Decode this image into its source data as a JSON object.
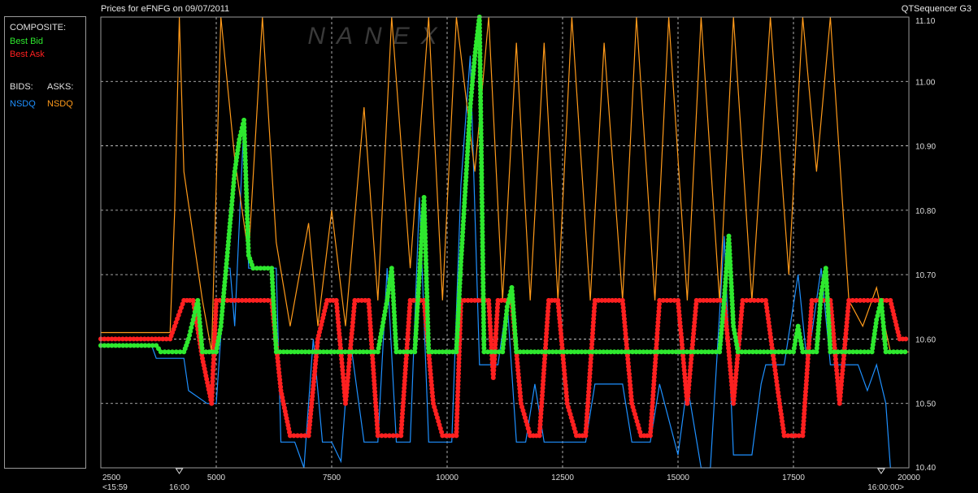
{
  "header": {
    "title": "Prices for  eFNFG  on  09/07/2011",
    "app_name": "QTSequencer G3"
  },
  "watermark": "NANEX",
  "legend": {
    "composite_label": "COMPOSITE:",
    "best_bid_label": "Best Bid",
    "best_ask_label": "Best Ask",
    "bids_label": "BIDS:",
    "asks_label": "ASKS:",
    "bids_exchange": "NSDQ",
    "asks_exchange": "NSDQ"
  },
  "colors": {
    "background": "#000000",
    "best_bid": "#2ee82e",
    "best_ask": "#ff2020",
    "bids_nsdq": "#1e90ff",
    "asks_nsdq": "#ff9a1a",
    "grid": "#d8d8d8",
    "frame": "#9a9a9a"
  },
  "chart_data": {
    "type": "line",
    "ylim": [
      10.4,
      11.1
    ],
    "xlim": [
      2500,
      20000
    ],
    "grid": true,
    "y_ticks": [
      "11.10",
      "11.00",
      "10.90",
      "10.80",
      "10.70",
      "10.60",
      "10.50",
      "10.40"
    ],
    "y_tick_values": [
      11.1,
      11.0,
      10.9,
      10.8,
      10.7,
      10.6,
      10.5,
      10.4
    ],
    "x_ticks": [
      "2500",
      "5000",
      "7500",
      "10000",
      "12500",
      "15000",
      "17500",
      "20000"
    ],
    "x_tick_values": [
      2500,
      5000,
      7500,
      10000,
      12500,
      15000,
      17500,
      20000
    ],
    "x_grid_values": [
      5000,
      7500,
      10000,
      12500,
      15000,
      17500
    ],
    "x_sub_labels": [
      "<15:59",
      "16:00",
      "16:00:00>"
    ],
    "x_sub_label_values": [
      2500,
      4200,
      19500
    ],
    "x_markers": [
      4200,
      19400
    ],
    "series": [
      {
        "name": "Best Bid",
        "role": "composite_bid",
        "points": [
          [
            2500,
            10.59
          ],
          [
            3700,
            10.59
          ],
          [
            3800,
            10.58
          ],
          [
            4300,
            10.58
          ],
          [
            4400,
            10.6
          ],
          [
            4500,
            10.63
          ],
          [
            4600,
            10.66
          ],
          [
            4700,
            10.58
          ],
          [
            5000,
            10.58
          ],
          [
            5100,
            10.62
          ],
          [
            5200,
            10.7
          ],
          [
            5300,
            10.78
          ],
          [
            5400,
            10.86
          ],
          [
            5500,
            10.91
          ],
          [
            5600,
            10.94
          ],
          [
            5700,
            10.73
          ],
          [
            5800,
            10.71
          ],
          [
            6200,
            10.71
          ],
          [
            6300,
            10.58
          ],
          [
            8500,
            10.58
          ],
          [
            8600,
            10.62
          ],
          [
            8700,
            10.66
          ],
          [
            8800,
            10.71
          ],
          [
            8900,
            10.58
          ],
          [
            9300,
            10.58
          ],
          [
            9400,
            10.7
          ],
          [
            9500,
            10.82
          ],
          [
            9600,
            10.58
          ],
          [
            10200,
            10.58
          ],
          [
            10300,
            10.72
          ],
          [
            10400,
            10.84
          ],
          [
            10500,
            10.96
          ],
          [
            10600,
            11.04
          ],
          [
            10700,
            11.1
          ],
          [
            10800,
            10.58
          ],
          [
            11200,
            10.58
          ],
          [
            11300,
            10.65
          ],
          [
            11400,
            10.68
          ],
          [
            11500,
            10.58
          ],
          [
            15900,
            10.58
          ],
          [
            16000,
            10.66
          ],
          [
            16100,
            10.76
          ],
          [
            16200,
            10.62
          ],
          [
            16300,
            10.58
          ],
          [
            17500,
            10.58
          ],
          [
            17600,
            10.62
          ],
          [
            17700,
            10.58
          ],
          [
            18000,
            10.58
          ],
          [
            18100,
            10.67
          ],
          [
            18200,
            10.71
          ],
          [
            18300,
            10.58
          ],
          [
            19200,
            10.58
          ],
          [
            19300,
            10.63
          ],
          [
            19400,
            10.66
          ],
          [
            19500,
            10.58
          ],
          [
            20000,
            10.58
          ]
        ]
      },
      {
        "name": "Best Ask",
        "role": "composite_ask",
        "points": [
          [
            2500,
            10.6
          ],
          [
            4000,
            10.6
          ],
          [
            4100,
            10.62
          ],
          [
            4300,
            10.66
          ],
          [
            4500,
            10.66
          ],
          [
            4700,
            10.57
          ],
          [
            4900,
            10.5
          ],
          [
            5000,
            10.66
          ],
          [
            6200,
            10.66
          ],
          [
            6400,
            10.52
          ],
          [
            6600,
            10.45
          ],
          [
            7000,
            10.45
          ],
          [
            7200,
            10.6
          ],
          [
            7400,
            10.66
          ],
          [
            7600,
            10.66
          ],
          [
            7800,
            10.5
          ],
          [
            8000,
            10.66
          ],
          [
            8300,
            10.66
          ],
          [
            8500,
            10.45
          ],
          [
            9000,
            10.45
          ],
          [
            9200,
            10.66
          ],
          [
            9500,
            10.66
          ],
          [
            9700,
            10.5
          ],
          [
            9900,
            10.45
          ],
          [
            10200,
            10.45
          ],
          [
            10300,
            10.66
          ],
          [
            10900,
            10.66
          ],
          [
            11000,
            10.54
          ],
          [
            11100,
            10.66
          ],
          [
            11400,
            10.66
          ],
          [
            11600,
            10.5
          ],
          [
            11800,
            10.45
          ],
          [
            12000,
            10.45
          ],
          [
            12200,
            10.66
          ],
          [
            12400,
            10.66
          ],
          [
            12600,
            10.5
          ],
          [
            12800,
            10.45
          ],
          [
            13000,
            10.45
          ],
          [
            13200,
            10.66
          ],
          [
            13800,
            10.66
          ],
          [
            14000,
            10.5
          ],
          [
            14200,
            10.45
          ],
          [
            14400,
            10.45
          ],
          [
            14600,
            10.66
          ],
          [
            15000,
            10.66
          ],
          [
            15200,
            10.5
          ],
          [
            15400,
            10.66
          ],
          [
            16000,
            10.66
          ],
          [
            16200,
            10.5
          ],
          [
            16400,
            10.66
          ],
          [
            16900,
            10.66
          ],
          [
            17200,
            10.5
          ],
          [
            17300,
            10.45
          ],
          [
            17700,
            10.45
          ],
          [
            17900,
            10.66
          ],
          [
            18300,
            10.66
          ],
          [
            18500,
            10.5
          ],
          [
            18700,
            10.66
          ],
          [
            19600,
            10.66
          ],
          [
            19800,
            10.6
          ],
          [
            20000,
            10.6
          ]
        ]
      },
      {
        "name": "NSDQ",
        "role": "bids",
        "points": [
          [
            2500,
            10.59
          ],
          [
            3600,
            10.59
          ],
          [
            3700,
            10.57
          ],
          [
            4300,
            10.57
          ],
          [
            4400,
            10.52
          ],
          [
            4800,
            10.5
          ],
          [
            5000,
            10.5
          ],
          [
            5200,
            10.71
          ],
          [
            5300,
            10.71
          ],
          [
            5400,
            10.62
          ],
          [
            5600,
            10.94
          ],
          [
            5700,
            10.71
          ],
          [
            6300,
            10.71
          ],
          [
            6400,
            10.44
          ],
          [
            6700,
            10.44
          ],
          [
            6900,
            10.4
          ],
          [
            7100,
            10.6
          ],
          [
            7300,
            10.44
          ],
          [
            7500,
            10.44
          ],
          [
            7700,
            10.41
          ],
          [
            7900,
            10.6
          ],
          [
            8200,
            10.44
          ],
          [
            8500,
            10.44
          ],
          [
            8700,
            10.71
          ],
          [
            8900,
            10.44
          ],
          [
            9200,
            10.44
          ],
          [
            9400,
            10.82
          ],
          [
            9600,
            10.44
          ],
          [
            10100,
            10.44
          ],
          [
            10300,
            10.84
          ],
          [
            10500,
            11.04
          ],
          [
            10700,
            10.56
          ],
          [
            11100,
            10.56
          ],
          [
            11300,
            10.66
          ],
          [
            11500,
            10.44
          ],
          [
            11700,
            10.44
          ],
          [
            11900,
            10.53
          ],
          [
            12100,
            10.44
          ],
          [
            13000,
            10.44
          ],
          [
            13200,
            10.53
          ],
          [
            13800,
            10.53
          ],
          [
            14000,
            10.44
          ],
          [
            14400,
            10.44
          ],
          [
            14600,
            10.53
          ],
          [
            15000,
            10.42
          ],
          [
            15200,
            10.53
          ],
          [
            15500,
            10.4
          ],
          [
            15700,
            10.4
          ],
          [
            16000,
            10.76
          ],
          [
            16200,
            10.42
          ],
          [
            16600,
            10.42
          ],
          [
            16800,
            10.53
          ],
          [
            16900,
            10.56
          ],
          [
            17300,
            10.56
          ],
          [
            17600,
            10.7
          ],
          [
            17800,
            10.56
          ],
          [
            18100,
            10.71
          ],
          [
            18300,
            10.56
          ],
          [
            18900,
            10.56
          ],
          [
            19100,
            10.52
          ],
          [
            19300,
            10.56
          ],
          [
            19500,
            10.5
          ],
          [
            19600,
            10.4
          ]
        ]
      },
      {
        "name": "NSDQ",
        "role": "asks",
        "points": [
          [
            2500,
            10.61
          ],
          [
            4000,
            10.61
          ],
          [
            4100,
            10.8
          ],
          [
            4200,
            11.1
          ],
          [
            4300,
            10.86
          ],
          [
            4700,
            10.66
          ],
          [
            4900,
            10.58
          ],
          [
            5100,
            11.1
          ],
          [
            5400,
            10.88
          ],
          [
            5700,
            10.73
          ],
          [
            6000,
            11.1
          ],
          [
            6300,
            10.75
          ],
          [
            6600,
            10.62
          ],
          [
            7000,
            10.78
          ],
          [
            7200,
            10.62
          ],
          [
            7500,
            10.8
          ],
          [
            7800,
            10.62
          ],
          [
            8200,
            10.96
          ],
          [
            8500,
            10.66
          ],
          [
            8800,
            11.1
          ],
          [
            9200,
            10.71
          ],
          [
            9600,
            11.1
          ],
          [
            9900,
            10.66
          ],
          [
            10200,
            11.1
          ],
          [
            10600,
            10.86
          ],
          [
            10900,
            11.1
          ],
          [
            11200,
            10.66
          ],
          [
            11500,
            11.06
          ],
          [
            11800,
            10.66
          ],
          [
            12100,
            11.06
          ],
          [
            12400,
            10.66
          ],
          [
            12700,
            11.1
          ],
          [
            13100,
            10.66
          ],
          [
            13400,
            11.06
          ],
          [
            13800,
            10.66
          ],
          [
            14100,
            11.1
          ],
          [
            14500,
            10.66
          ],
          [
            14800,
            11.1
          ],
          [
            15200,
            10.66
          ],
          [
            15500,
            11.1
          ],
          [
            15900,
            10.66
          ],
          [
            16200,
            11.1
          ],
          [
            16600,
            10.66
          ],
          [
            17000,
            11.1
          ],
          [
            17400,
            10.7
          ],
          [
            17700,
            11.1
          ],
          [
            18000,
            10.86
          ],
          [
            18300,
            11.1
          ],
          [
            18700,
            10.66
          ],
          [
            19000,
            10.62
          ],
          [
            19300,
            10.68
          ],
          [
            19600,
            10.58
          ],
          [
            20000,
            10.58
          ]
        ]
      }
    ]
  }
}
